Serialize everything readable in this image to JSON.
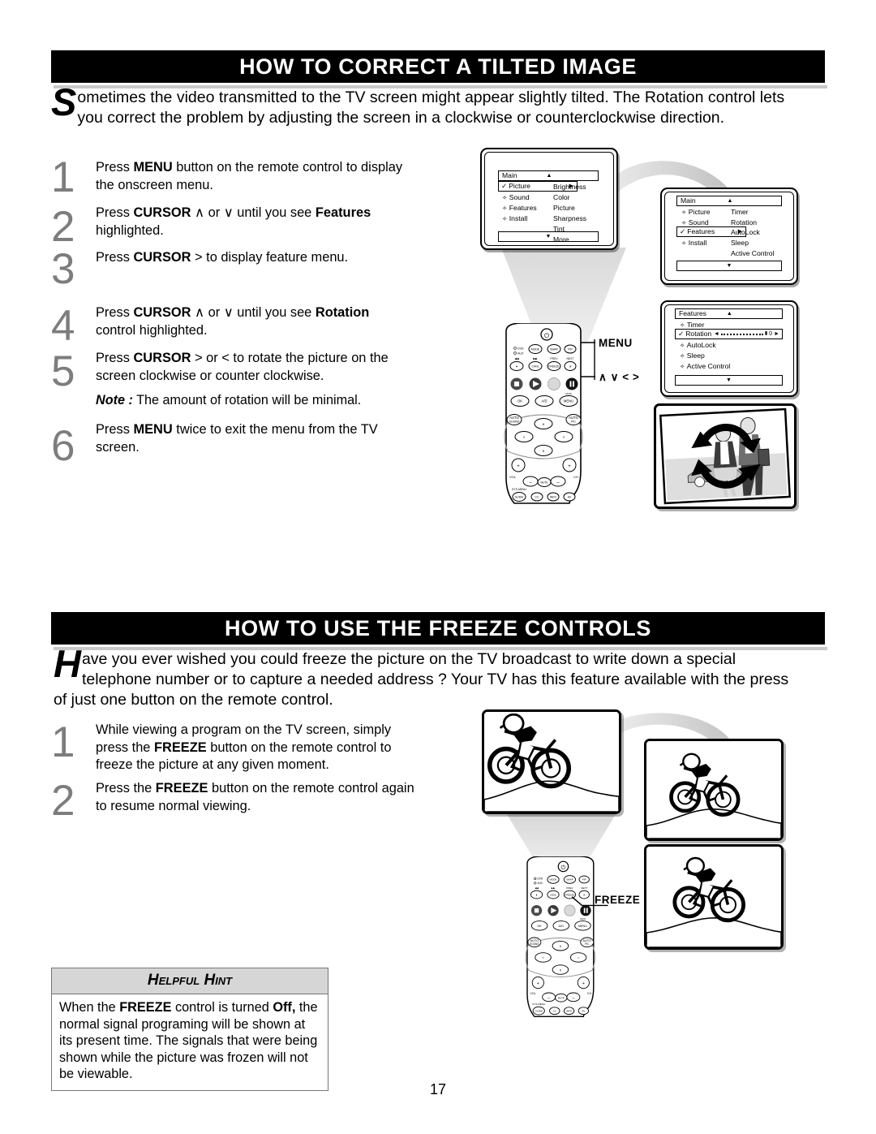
{
  "page_number": "17",
  "sections": [
    {
      "id": "tilted-image",
      "title": "HOW TO CORRECT A TILTED IMAGE",
      "intro_dropcap": "S",
      "intro_text": "ometimes the video transmitted to the TV screen might appear slightly tilted. The Rotation control lets you correct the problem by adjusting the screen in a clockwise or counterclockwise direction.",
      "steps": [
        {
          "num": "1",
          "line1_a": "Press ",
          "line1_b": "MENU",
          "line1_c": " button on the remote control to  display",
          "line2": "the onscreen menu."
        },
        {
          "num": "2",
          "line1_a": "Press ",
          "line1_b": "CURSOR",
          "line1_c": " ∧  or  ∨ until you see ",
          "line1_d": "Features",
          "line2": "highlighted."
        },
        {
          "num": "3",
          "line1_a": "Press ",
          "line1_b": "CURSOR",
          "line1_c": "  > to display feature menu.",
          "line2": ""
        },
        {
          "num": "4",
          "line1_a": "Press ",
          "line1_b": "CURSOR",
          "line1_c": " ∧  or  ∨ until you see ",
          "line1_d": "Rotation",
          "line2": "control highlighted."
        },
        {
          "num": "5",
          "line1_a": "Press ",
          "line1_b": "CURSOR",
          "line1_c": " >  or <  to rotate the picture on the",
          "line2": "screen clockwise or counter clockwise."
        },
        {
          "num": "6",
          "line1_a": "Press ",
          "line1_b": "MENU",
          "line1_c": " twice to exit the menu from the TV",
          "line2": "screen."
        }
      ],
      "note_label": "Note :",
      "note_text": " The amount of rotation will be minimal."
    },
    {
      "id": "freeze-controls",
      "title": "HOW TO USE THE FREEZE CONTROLS",
      "intro_dropcap": "H",
      "intro_text": "ave you ever wished you could freeze the picture on the TV broadcast to write down a special telephone number or to capture a needed address ? Your TV has this feature available with the press of just one button on the remote control.",
      "steps": [
        {
          "num": "1",
          "line1_a": "While viewing a program on the TV screen, simply",
          "line2_a": "press the ",
          "line2_b": "FREEZE",
          "line2_c": " button on the remote control to",
          "line3": "freeze the picture at any given moment."
        },
        {
          "num": "2",
          "line1_a": "Press the ",
          "line1_b": "FREEZE",
          "line1_c": " button on the remote control again",
          "line2": "to resume normal viewing."
        }
      ]
    }
  ],
  "osd_menus": [
    {
      "id": "main-picture",
      "title": "Main",
      "up_arrow": "▲",
      "down_arrow": "▼",
      "items": [
        {
          "label": "Picture",
          "selected": true,
          "check": "✓",
          "bullet": "✧",
          "arrow": "▶"
        },
        {
          "label": "Sound",
          "selected": false,
          "bullet": "✧"
        },
        {
          "label": "Features",
          "selected": false,
          "bullet": "✧"
        },
        {
          "label": "Install",
          "selected": false,
          "bullet": "✧"
        }
      ],
      "submenu": [
        "Brightness",
        "Color",
        "Picture",
        "Sharpness",
        "Tint",
        "More..."
      ]
    },
    {
      "id": "main-features",
      "title": "Main",
      "up_arrow": "▲",
      "down_arrow": "▼",
      "items": [
        {
          "label": "Picture",
          "selected": false,
          "bullet": "✧"
        },
        {
          "label": "Sound",
          "selected": false,
          "bullet": "✧"
        },
        {
          "label": "Features",
          "selected": true,
          "check": "✓",
          "bullet": "✧",
          "arrow": "▶"
        },
        {
          "label": "Install",
          "selected": false,
          "bullet": "✧"
        }
      ],
      "submenu": [
        "Timer",
        "Rotation",
        "AutoLock",
        "Sleep",
        "Active Control"
      ]
    },
    {
      "id": "features-rotation",
      "title": "Features",
      "up_arrow": "▲",
      "down_arrow": "▼",
      "items": [
        {
          "label": "Timer",
          "selected": false,
          "bullet": "✧"
        },
        {
          "label": "Rotation",
          "selected": true,
          "check": "✓",
          "bullet": "✧",
          "slider": {
            "left_arrow": "◄",
            "right_arrow": "►",
            "value": "0",
            "marker": "▮"
          }
        },
        {
          "label": "AutoLock",
          "selected": false,
          "bullet": "✧"
        },
        {
          "label": "Sleep",
          "selected": false,
          "bullet": "✧"
        },
        {
          "label": "Active Control",
          "selected": false,
          "bullet": "✧"
        }
      ],
      "submenu": []
    }
  ],
  "callouts": {
    "menu": "MENU",
    "cursor_arrows": "∧ ∨ < >",
    "freeze": "FREEZE"
  },
  "remote_labels": {
    "dvd": "DVD",
    "aux": "AUX",
    "mode": "MODE",
    "swap": "SWAP",
    "pip": "PIP",
    "prev": "PREV",
    "next": "NEXT",
    "ok": "OK",
    "ad": "A/D",
    "menu": "MENU",
    "main": "MAIN",
    "auto_sound": "AUTO SOUND",
    "auto_pic": "AUTO PIC",
    "vol": "VOL",
    "ch": "CH",
    "mute": "MUTE",
    "sys_menu": "SYS-MENU",
    "guide": "GUIDE",
    "cc": "CC",
    "info": "INFO",
    "av": "AV"
  },
  "hint": {
    "title": "Helpful Hint",
    "body_a": "When the ",
    "body_b": "FREEZE",
    "body_c": " control is turned ",
    "body_d": "Off,",
    "body_e": " the normal signal programing will be shown at its present time. The signals that were being shown while the picture was frozen will not be viewable."
  },
  "colors": {
    "header_bg": "#000000",
    "header_text": "#ffffff",
    "step_number": "#7d7d7d",
    "hint_header_bg": "#d6d6d6",
    "connector_gray": "#c8c8c8"
  }
}
